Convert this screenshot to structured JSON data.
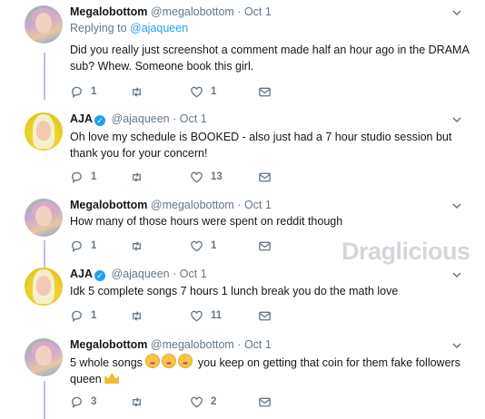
{
  "tweets": [
    {
      "name": "Megalobottom",
      "handle": "@megalobottom",
      "time": "Oct 1",
      "verified": false,
      "replying_prefix": "Replying to ",
      "replying_to": "@ajaqueen",
      "text_lines": [
        "Did you really just screenshot a comment made half an hour ago in the DRAMA",
        "sub? Whew. Someone book this girl."
      ],
      "replies": "1",
      "retweets": "",
      "likes": "1"
    },
    {
      "name": "AJA",
      "handle": "@ajaqueen",
      "time": "Oct 1",
      "verified": true,
      "text_lines": [
        "Oh love my schedule is BOOKED - also just had a 7 hour studio session but",
        "thank you for your concern!"
      ],
      "replies": "1",
      "retweets": "",
      "likes": "13"
    },
    {
      "name": "Megalobottom",
      "handle": "@megalobottom",
      "time": "Oct 1",
      "verified": false,
      "text_lines": [
        "How many of those hours were spent on reddit though"
      ],
      "replies": "1",
      "retweets": "",
      "likes": "1"
    },
    {
      "name": "AJA",
      "handle": "@ajaqueen",
      "time": "Oct 1",
      "verified": true,
      "text_lines": [
        "Idk 5 complete songs 7 hours 1 lunch break you do the math love"
      ],
      "replies": "1",
      "retweets": "",
      "likes": "11"
    },
    {
      "name": "Megalobottom",
      "handle": "@megalobottom",
      "time": "Oct 1",
      "verified": false,
      "text_line1_start": "5 whole songs",
      "text_line1_end": " you keep on getting that coin for them fake followers",
      "text_line2": "queen",
      "emojis": [
        "flushed-face",
        "flushed-face",
        "flushed-face",
        "crown"
      ],
      "replies": "3",
      "retweets": "",
      "likes": "2"
    }
  ],
  "separator": "·",
  "verified_glyph": "✓",
  "watermark": "Draglicious",
  "colors": {
    "link": "#1da1f2",
    "muted": "#657786",
    "thread": "#c8b8f0"
  }
}
